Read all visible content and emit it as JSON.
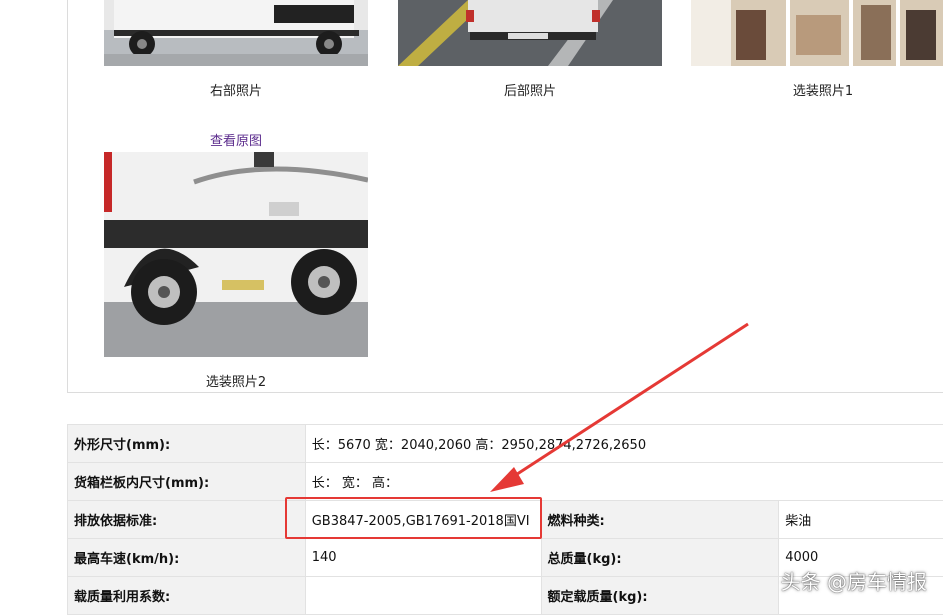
{
  "gallery": {
    "items": [
      {
        "caption": "右部照片"
      },
      {
        "caption": "后部照片"
      },
      {
        "caption": "选装照片1"
      },
      {
        "caption": "选装照片2"
      }
    ],
    "view_original_link": "查看原图"
  },
  "spec_table": {
    "rows": [
      {
        "label": "外形尺寸(mm):",
        "value": "长：5670 宽：2040,2060 高：2950,2874,2726,2650"
      },
      {
        "label": "货箱栏板内尺寸(mm):",
        "value": "长：   宽：   高："
      },
      {
        "label": "排放依据标准:",
        "value": "GB3847-2005,GB17691-2018国VI",
        "label2": "燃料种类:",
        "value2": "柴油"
      },
      {
        "label": "最高车速(km/h):",
        "value": "140",
        "label2": "总质量(kg):",
        "value2": "4000"
      },
      {
        "label": "载质量利用系数:",
        "value": "",
        "label2": "额定载质量(kg):",
        "value2": ""
      }
    ]
  },
  "annotation": {
    "color": "#e53935"
  },
  "watermark": {
    "text": "头条 @房车情报"
  }
}
